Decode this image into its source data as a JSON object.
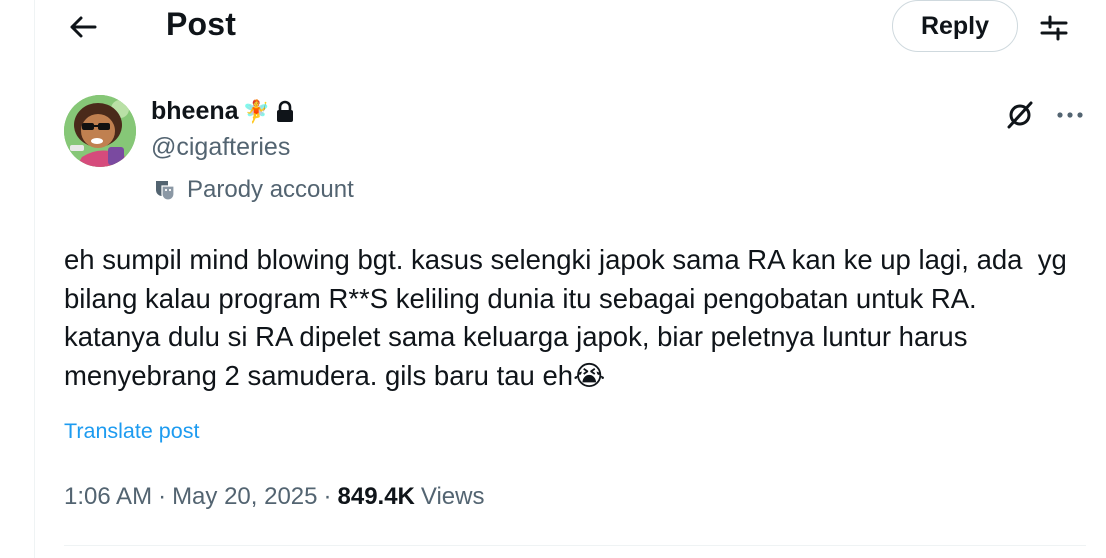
{
  "header": {
    "title": "Post",
    "back_icon": "arrow-left-icon",
    "reply_label": "Reply",
    "settings_icon": "sliders-icon"
  },
  "author": {
    "display_name": "bheena",
    "name_emoji": "🧚",
    "lock_icon": "lock-icon",
    "handle": "@cigafteries",
    "parody_label": "Parody account",
    "parody_icon": "theater-masks-icon"
  },
  "actions": {
    "grok_icon": "grok-icon",
    "more_icon": "more-horizontal-icon"
  },
  "post": {
    "text": "eh sumpil mind blowing bgt. kasus selengki japok sama RA kan ke up lagi, ada  yg bilang kalau program R**S keliling dunia itu sebagai pengobatan untuk RA. katanya dulu si RA dipelet sama keluarga japok, biar peletnya luntur harus menyebrang 2 samudera. gils baru tau eh",
    "trailing_emoji": "😭",
    "translate_label": "Translate post"
  },
  "meta": {
    "time": "1:06 AM",
    "separator": "·",
    "date": "May 20, 2025",
    "views_count": "849.4K",
    "views_label": "Views"
  },
  "colors": {
    "text_primary": "#0f1419",
    "text_secondary": "#536471",
    "link": "#1d9bf0",
    "border": "#cfd9de"
  }
}
